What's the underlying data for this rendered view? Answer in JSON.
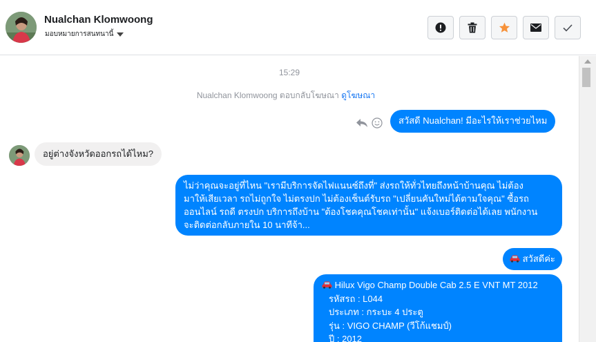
{
  "header": {
    "contact_name": "Nualchan Klomwoong",
    "assign_label": "มอบหมายการสนทนานี้",
    "actions": [
      {
        "icon": "alert-icon",
        "label": "spam"
      },
      {
        "icon": "trash-icon",
        "label": "delete"
      },
      {
        "icon": "star-icon",
        "label": "star"
      },
      {
        "icon": "mail-icon",
        "label": "unread"
      },
      {
        "icon": "check-icon",
        "label": "done"
      }
    ]
  },
  "chat": {
    "timestamp": "15:29",
    "system_prefix": "Nualchan Klomwoong ตอบกลับโฆษณา",
    "system_link": "ดูโฆษณา",
    "messages": {
      "greeting_out": "สวัสดี Nualchan! มีอะไรให้เราช่วยไหม",
      "question_in": "อยู่ต่างจังหวัดออกรถได้ไหม?",
      "long_out": {
        "line1": "ไม่ว่าคุณจะอยู่ที่ไหน \"เรามีบริการจัดไฟแนนซ์ถึงที่\"  ส่งรถให้ทั่วไทยถึงหน้าบ้านคุณ ไม่ต้อง",
        "line2": "มาให้เสียเวลา รถไม่ถูกใจ ไม่ตรงปก ไม่ต้องเซ็นต์รับรถ \"เปลี่ยนคันใหม่ได้ตามใจคุณ\" ซื้อรถ",
        "line3": "ออนไลน์ รถดี ตรงปก บริการถึงบ้าน \"ต้องโชคคุณโชคเท่านั้น\" แจ้งเบอร์ติดต่อได้เลย พนักงาน",
        "line4": "จะติดต่อกลับภายใน 10 นาทีจ้า..."
      },
      "hello_out": "สวัสดีค่ะ",
      "car_card": {
        "title": "Hilux Vigo Champ Double Cab 2.5 E VNT MT 2012",
        "code": "รหัสรถ : L044",
        "type": "ประเภท : กระบะ 4 ประตู",
        "model": "รุ่น : VIGO CHAMP (วีโก้แชมป์)",
        "year": "ปี : 2012"
      }
    }
  },
  "colors": {
    "outgoing_bubble": "#0084ff",
    "incoming_bubble": "#f1f0f0",
    "star": "#f7923a",
    "link": "#1877f2"
  }
}
